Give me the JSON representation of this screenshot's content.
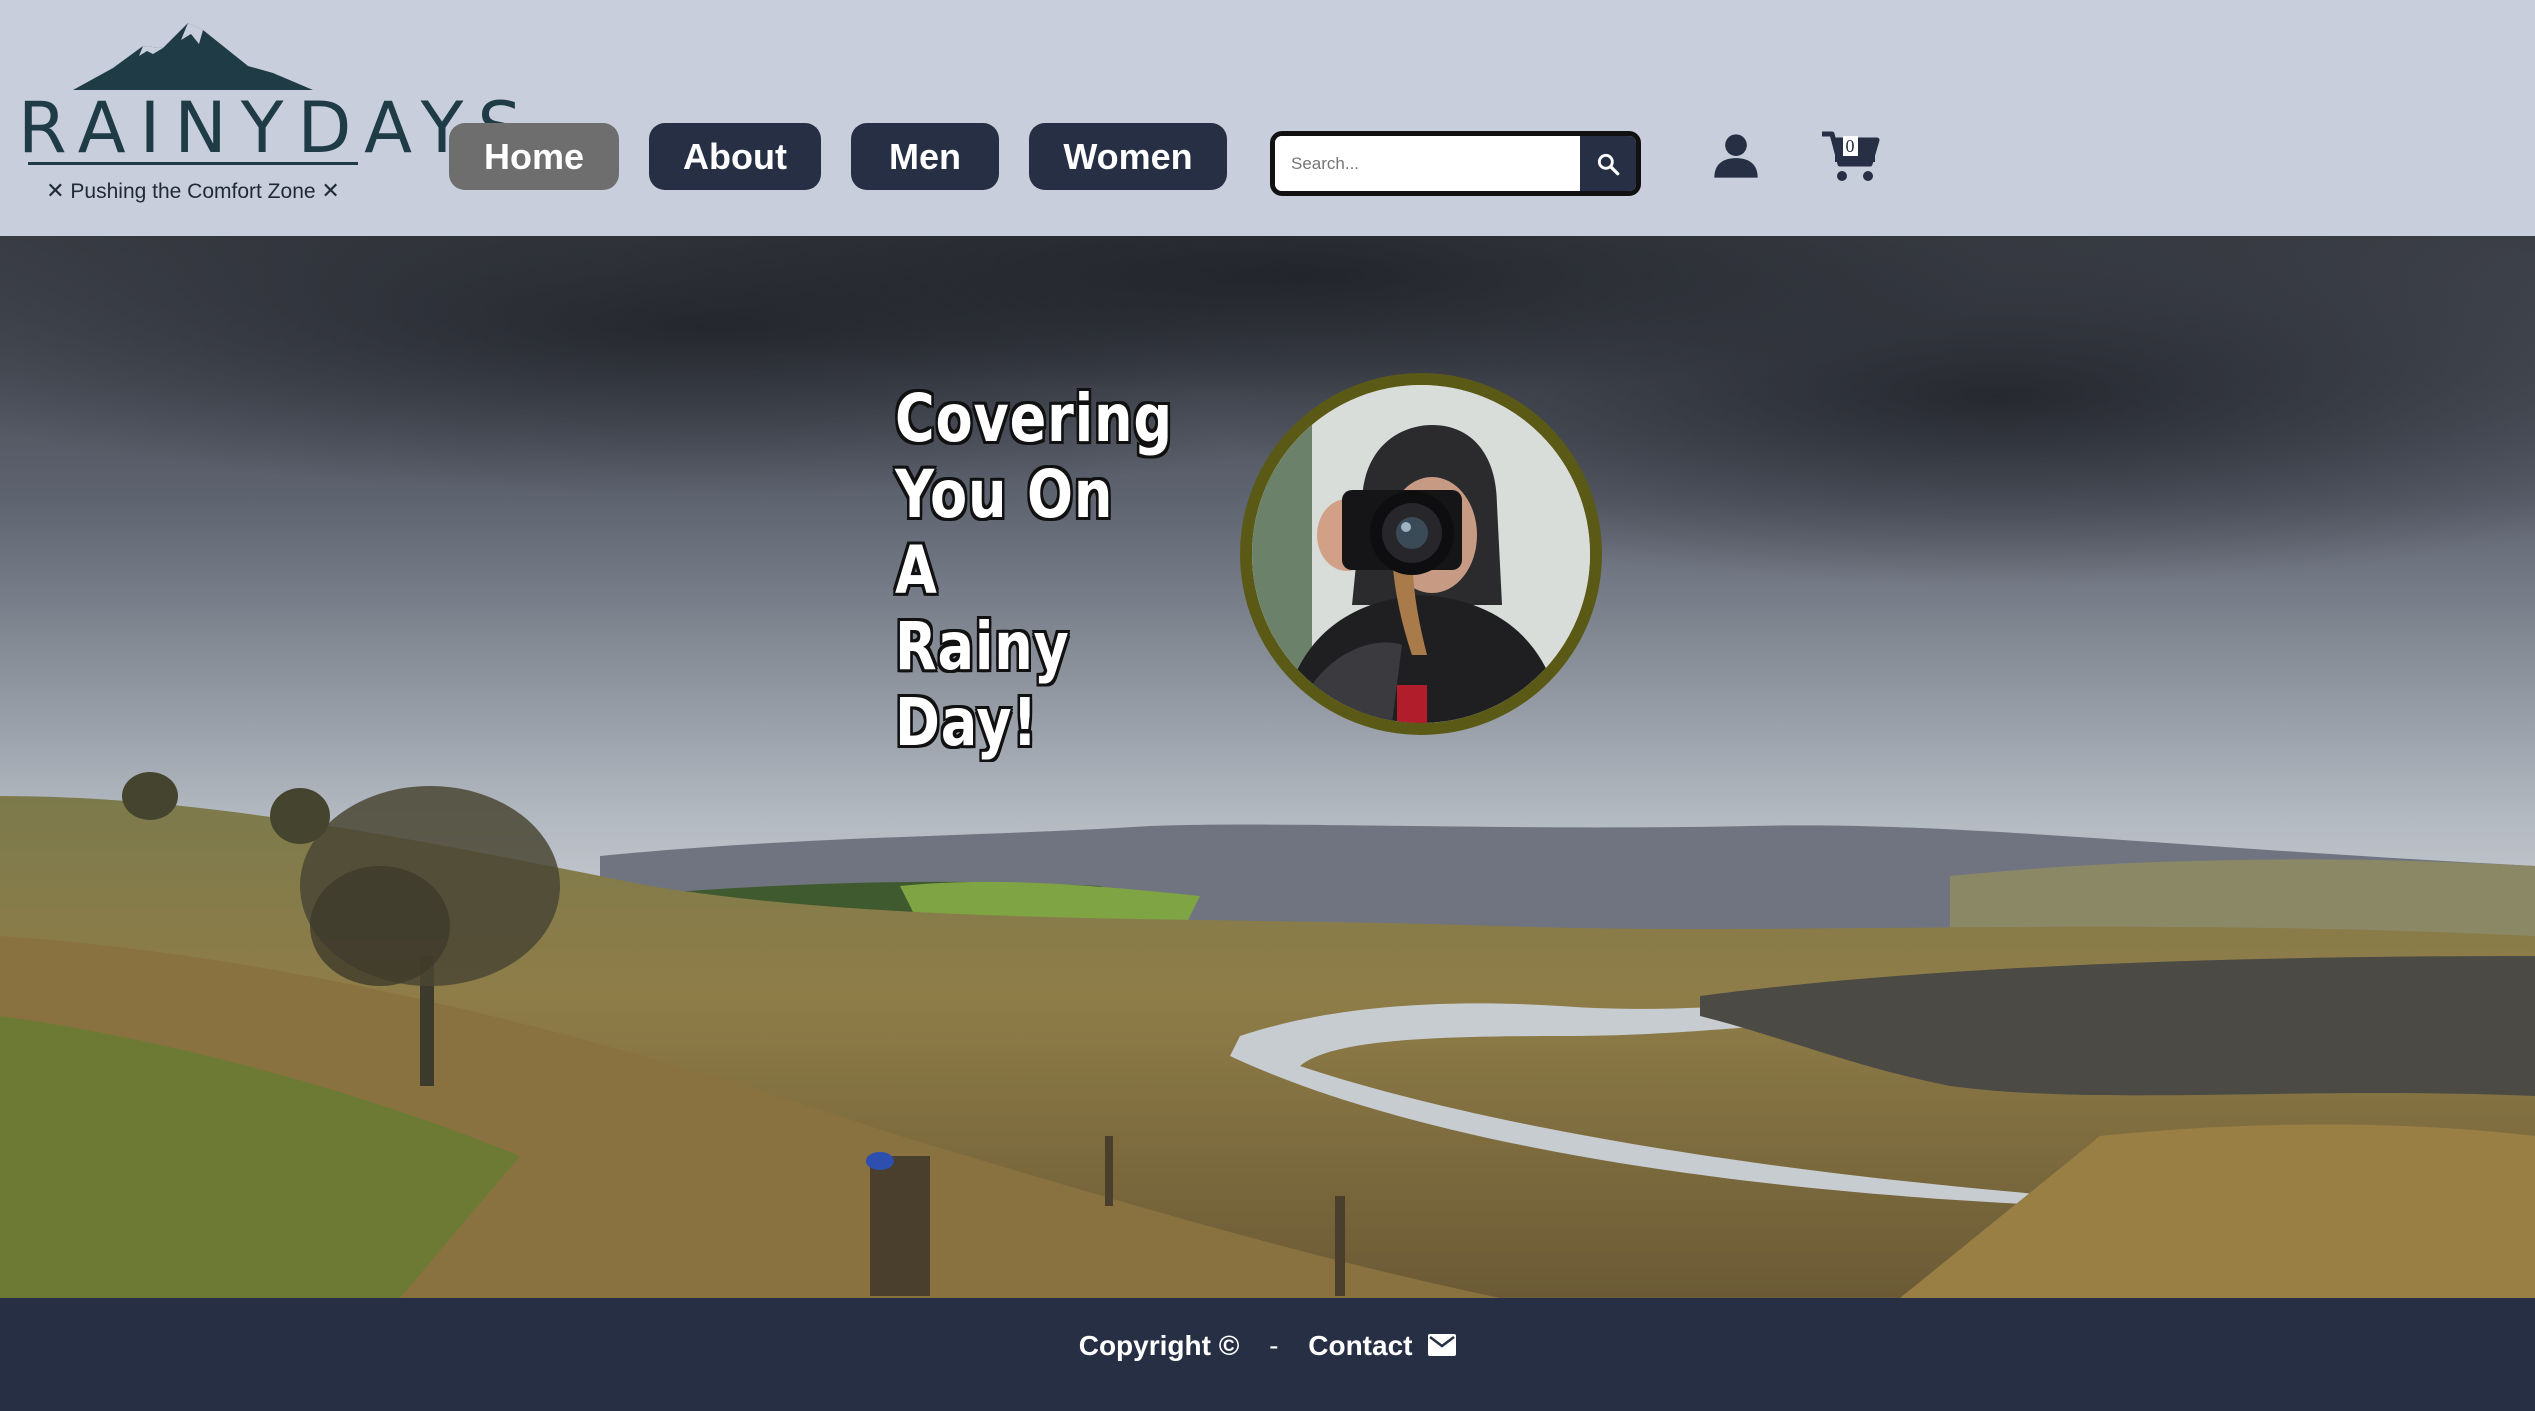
{
  "logo": {
    "wordmark": "RAINYDAYS",
    "tagline": "Pushing the Comfort Zone",
    "tagline_decoration": "✕"
  },
  "nav": {
    "home": "Home",
    "about": "About",
    "men": "Men",
    "women": "Women",
    "active": "Home"
  },
  "search": {
    "placeholder": "Search...",
    "icon": "search-icon"
  },
  "account": {
    "icon": "user-icon"
  },
  "cart": {
    "count": "0",
    "icon": "cart-icon"
  },
  "hero": {
    "headline_line1": "Covering",
    "headline_line2": "You On A",
    "headline_line3": "Rainy Day!"
  },
  "footer": {
    "copyright": "Copyright ©",
    "separator": "-",
    "contact": "Contact",
    "contact_icon": "mail-icon"
  },
  "colors": {
    "header_bg": "#c8cedb",
    "nav_bg": "#262f44",
    "nav_active_bg": "#6e6e6e",
    "footer_bg": "#262f44",
    "brand": "#1f3b45",
    "photo_border": "#5a5a16"
  }
}
